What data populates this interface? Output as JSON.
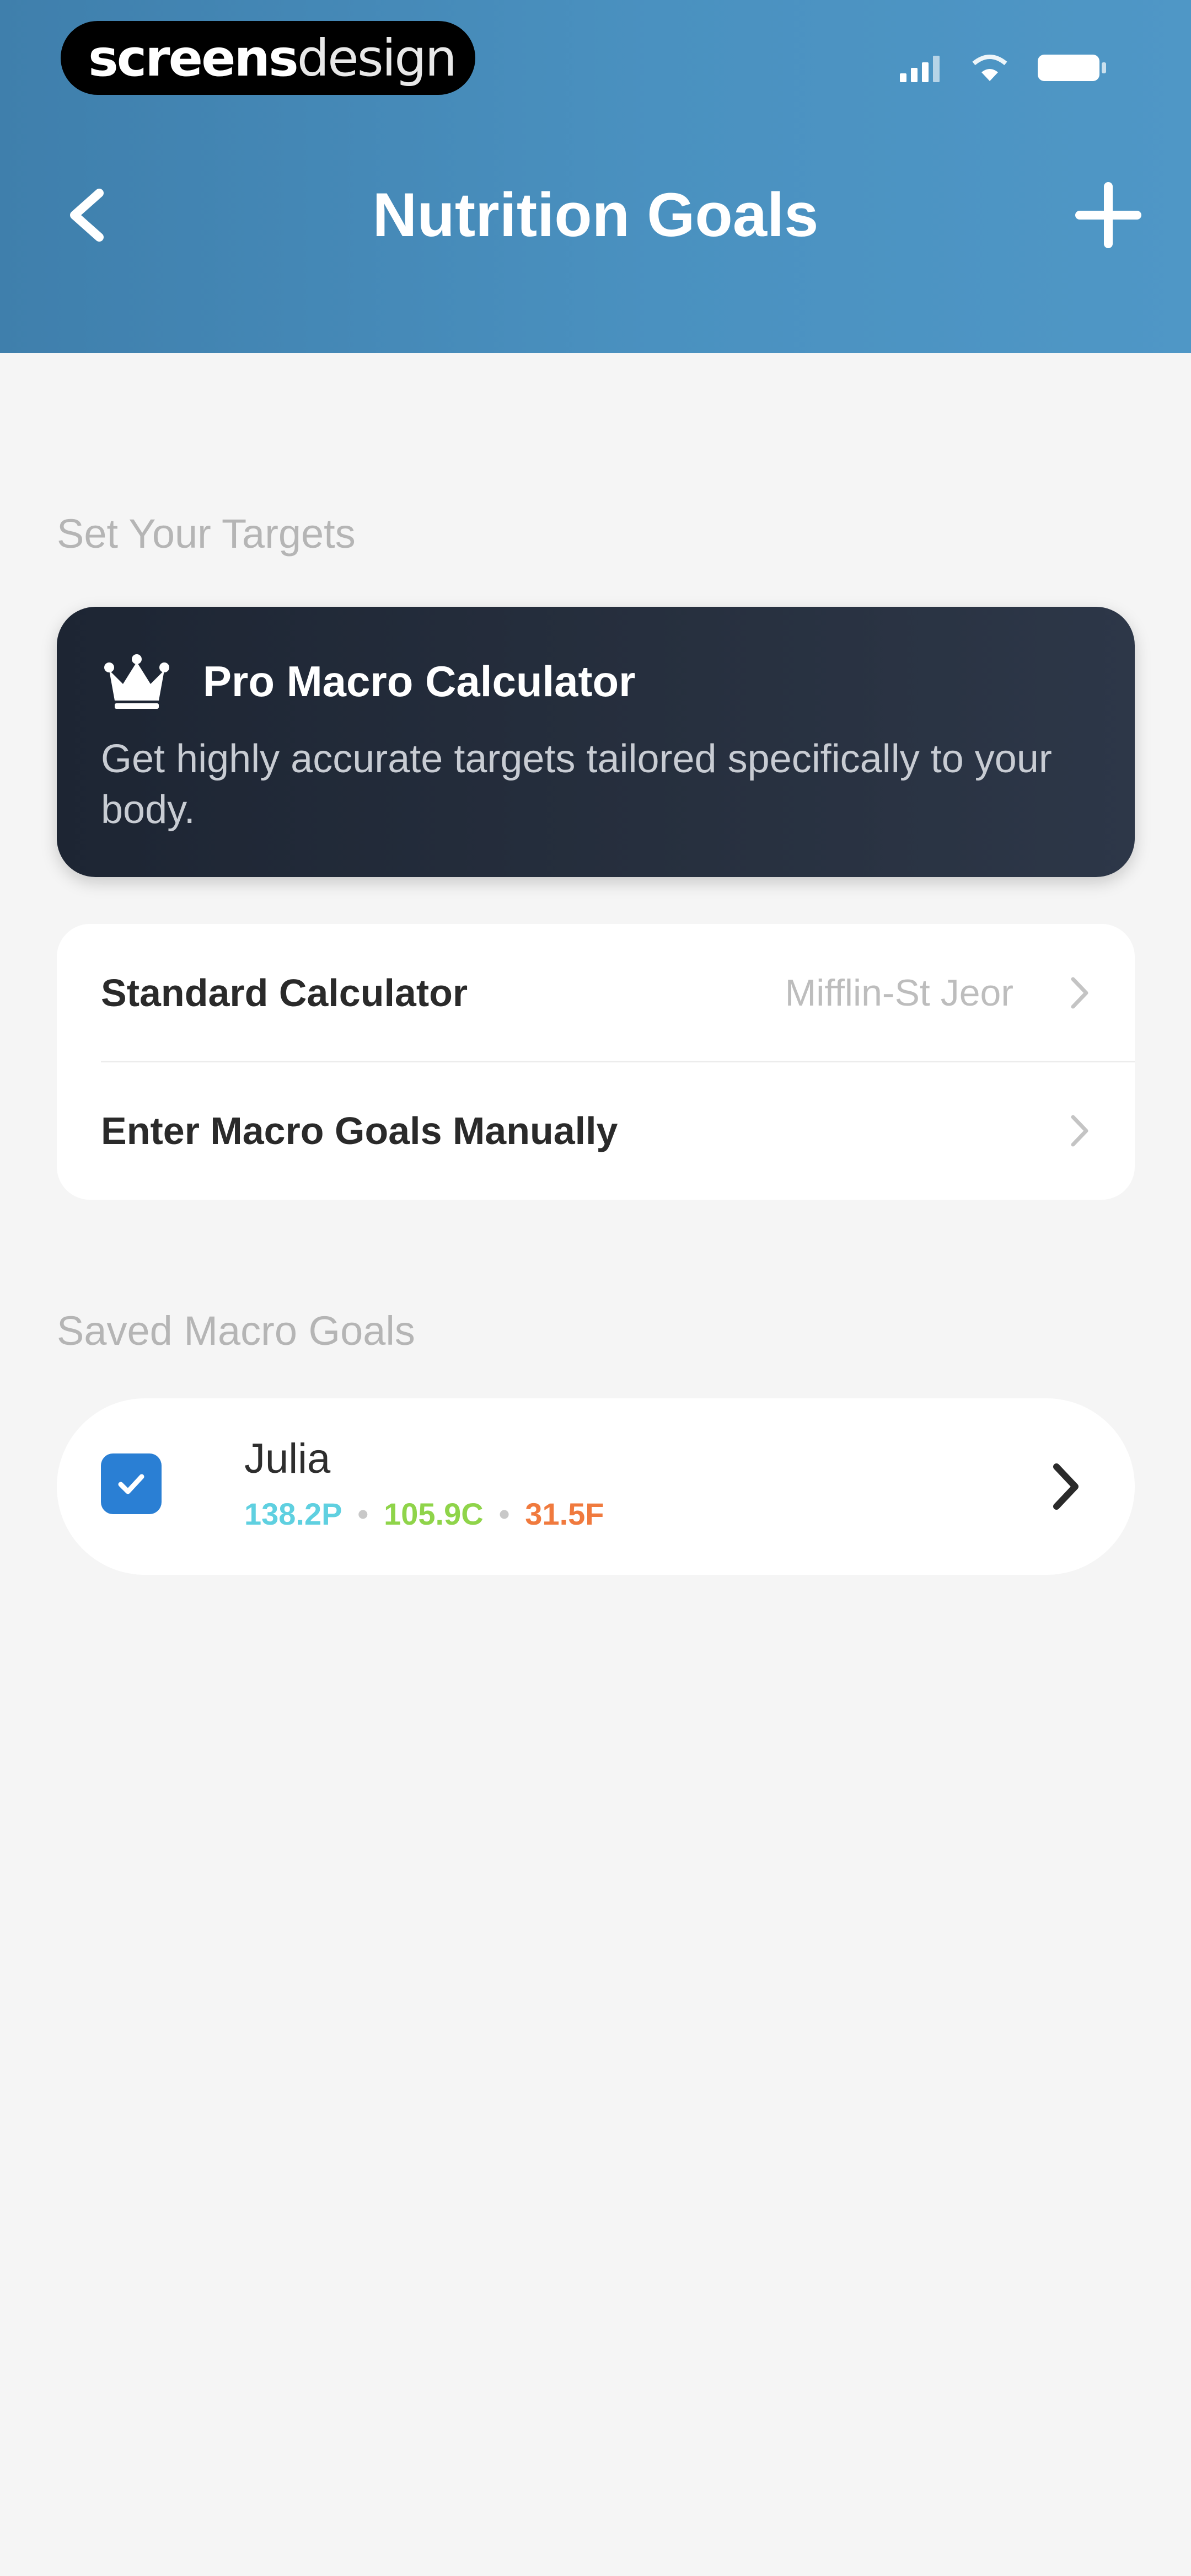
{
  "status_bar": {
    "brand_part1": "screens",
    "brand_part2": "design",
    "icons": [
      "signal-icon",
      "wifi-icon",
      "battery-icon"
    ]
  },
  "nav": {
    "title": "Nutrition Goals",
    "back_icon": "back-chevron-icon",
    "add_icon": "plus-icon"
  },
  "targets_section": {
    "label": "Set Your Targets",
    "pro_card": {
      "icon": "crown-icon",
      "title": "Pro Macro Calculator",
      "description": "Get highly accurate targets tailored specifically to your body."
    },
    "options": [
      {
        "label": "Standard Calculator",
        "value": "Mifflin-St Jeor"
      },
      {
        "label": "Enter Macro Goals Manually",
        "value": ""
      }
    ]
  },
  "saved_section": {
    "label": "Saved Macro Goals",
    "goals": [
      {
        "name": "Julia",
        "selected": true,
        "protein": "138.2P",
        "carbs": "105.9C",
        "fat": "31.5F"
      }
    ]
  },
  "colors": {
    "header": "#4a91c0",
    "pro_card": "#27303f",
    "check": "#2a7fd4",
    "protein": "#5fd0e0",
    "carbs": "#8fd44a",
    "fat": "#f07a3e"
  }
}
